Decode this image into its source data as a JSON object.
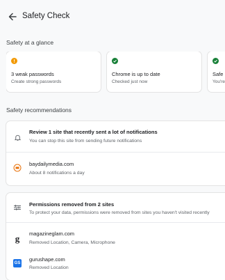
{
  "header": {
    "title": "Safety Check"
  },
  "glance": {
    "heading": "Safety at a glance",
    "cards": [
      {
        "title": "3 weak passwords",
        "subtitle": "Create strong passwords",
        "status": "warning",
        "color": "#f29900"
      },
      {
        "title": "Chrome is up to date",
        "subtitle": "Checked just now",
        "status": "ok",
        "color": "#188038"
      },
      {
        "title": "Safe B",
        "subtitle": "You're",
        "status": "ok",
        "color": "#188038"
      }
    ]
  },
  "recommendations": {
    "heading": "Safety recommendations",
    "notifications": {
      "title": "Review 1 site that recently sent a lot of notifications",
      "subtitle": "You can stop this site from sending future notifications",
      "site": {
        "name": "baydailymedia.com",
        "detail": "About 8 notifications a day"
      }
    },
    "permissions": {
      "title": "Permissions removed from 2 sites",
      "subtitle": "To protect your data, permissions were removed from sites you haven't visited recently",
      "sites": [
        {
          "name": "magazineglam.com",
          "detail": "Removed Location, Camera, Microphone",
          "favicon": "g"
        },
        {
          "name": "gurushape.com",
          "detail": "Removed Location",
          "favicon": "GS"
        }
      ]
    }
  }
}
